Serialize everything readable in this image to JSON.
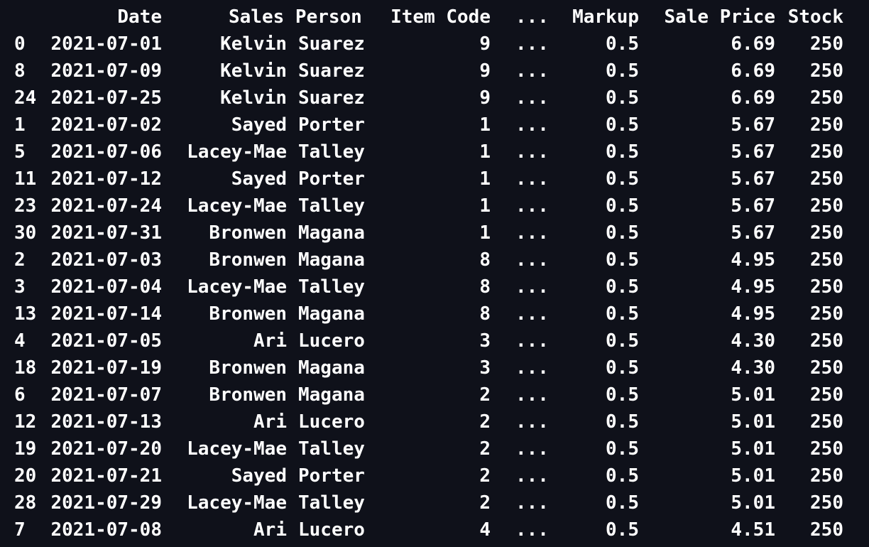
{
  "columns": {
    "date": "Date",
    "sales_person": "Sales Person",
    "item_code": "Item Code",
    "ellipsis": "...",
    "markup": "Markup",
    "sale_price": "Sale Price",
    "stock": "Stock"
  },
  "rows": [
    {
      "index": "0",
      "date": "2021-07-01",
      "first": "Kelvin",
      "last": "Suarez",
      "item_code": "9",
      "ellipsis": "...",
      "markup": "0.5",
      "sale_price": "6.69",
      "stock": "250"
    },
    {
      "index": "8",
      "date": "2021-07-09",
      "first": "Kelvin",
      "last": "Suarez",
      "item_code": "9",
      "ellipsis": "...",
      "markup": "0.5",
      "sale_price": "6.69",
      "stock": "250"
    },
    {
      "index": "24",
      "date": "2021-07-25",
      "first": "Kelvin",
      "last": "Suarez",
      "item_code": "9",
      "ellipsis": "...",
      "markup": "0.5",
      "sale_price": "6.69",
      "stock": "250"
    },
    {
      "index": "1",
      "date": "2021-07-02",
      "first": "Sayed",
      "last": "Porter",
      "item_code": "1",
      "ellipsis": "...",
      "markup": "0.5",
      "sale_price": "5.67",
      "stock": "250"
    },
    {
      "index": "5",
      "date": "2021-07-06",
      "first": "Lacey-Mae",
      "last": "Talley",
      "item_code": "1",
      "ellipsis": "...",
      "markup": "0.5",
      "sale_price": "5.67",
      "stock": "250"
    },
    {
      "index": "11",
      "date": "2021-07-12",
      "first": "Sayed",
      "last": "Porter",
      "item_code": "1",
      "ellipsis": "...",
      "markup": "0.5",
      "sale_price": "5.67",
      "stock": "250"
    },
    {
      "index": "23",
      "date": "2021-07-24",
      "first": "Lacey-Mae",
      "last": "Talley",
      "item_code": "1",
      "ellipsis": "...",
      "markup": "0.5",
      "sale_price": "5.67",
      "stock": "250"
    },
    {
      "index": "30",
      "date": "2021-07-31",
      "first": "Bronwen",
      "last": "Magana",
      "item_code": "1",
      "ellipsis": "...",
      "markup": "0.5",
      "sale_price": "5.67",
      "stock": "250"
    },
    {
      "index": "2",
      "date": "2021-07-03",
      "first": "Bronwen",
      "last": "Magana",
      "item_code": "8",
      "ellipsis": "...",
      "markup": "0.5",
      "sale_price": "4.95",
      "stock": "250"
    },
    {
      "index": "3",
      "date": "2021-07-04",
      "first": "Lacey-Mae",
      "last": "Talley",
      "item_code": "8",
      "ellipsis": "...",
      "markup": "0.5",
      "sale_price": "4.95",
      "stock": "250"
    },
    {
      "index": "13",
      "date": "2021-07-14",
      "first": "Bronwen",
      "last": "Magana",
      "item_code": "8",
      "ellipsis": "...",
      "markup": "0.5",
      "sale_price": "4.95",
      "stock": "250"
    },
    {
      "index": "4",
      "date": "2021-07-05",
      "first": "Ari",
      "last": "Lucero",
      "item_code": "3",
      "ellipsis": "...",
      "markup": "0.5",
      "sale_price": "4.30",
      "stock": "250"
    },
    {
      "index": "18",
      "date": "2021-07-19",
      "first": "Bronwen",
      "last": "Magana",
      "item_code": "3",
      "ellipsis": "...",
      "markup": "0.5",
      "sale_price": "4.30",
      "stock": "250"
    },
    {
      "index": "6",
      "date": "2021-07-07",
      "first": "Bronwen",
      "last": "Magana",
      "item_code": "2",
      "ellipsis": "...",
      "markup": "0.5",
      "sale_price": "5.01",
      "stock": "250"
    },
    {
      "index": "12",
      "date": "2021-07-13",
      "first": "Ari",
      "last": "Lucero",
      "item_code": "2",
      "ellipsis": "...",
      "markup": "0.5",
      "sale_price": "5.01",
      "stock": "250"
    },
    {
      "index": "19",
      "date": "2021-07-20",
      "first": "Lacey-Mae",
      "last": "Talley",
      "item_code": "2",
      "ellipsis": "...",
      "markup": "0.5",
      "sale_price": "5.01",
      "stock": "250"
    },
    {
      "index": "20",
      "date": "2021-07-21",
      "first": "Sayed",
      "last": "Porter",
      "item_code": "2",
      "ellipsis": "...",
      "markup": "0.5",
      "sale_price": "5.01",
      "stock": "250"
    },
    {
      "index": "28",
      "date": "2021-07-29",
      "first": "Lacey-Mae",
      "last": "Talley",
      "item_code": "2",
      "ellipsis": "...",
      "markup": "0.5",
      "sale_price": "5.01",
      "stock": "250"
    },
    {
      "index": "7",
      "date": "2021-07-08",
      "first": "Ari",
      "last": "Lucero",
      "item_code": "4",
      "ellipsis": "...",
      "markup": "0.5",
      "sale_price": "4.51",
      "stock": "250"
    }
  ],
  "colors": {
    "background": "#0f111a",
    "text": "#ffffff"
  }
}
